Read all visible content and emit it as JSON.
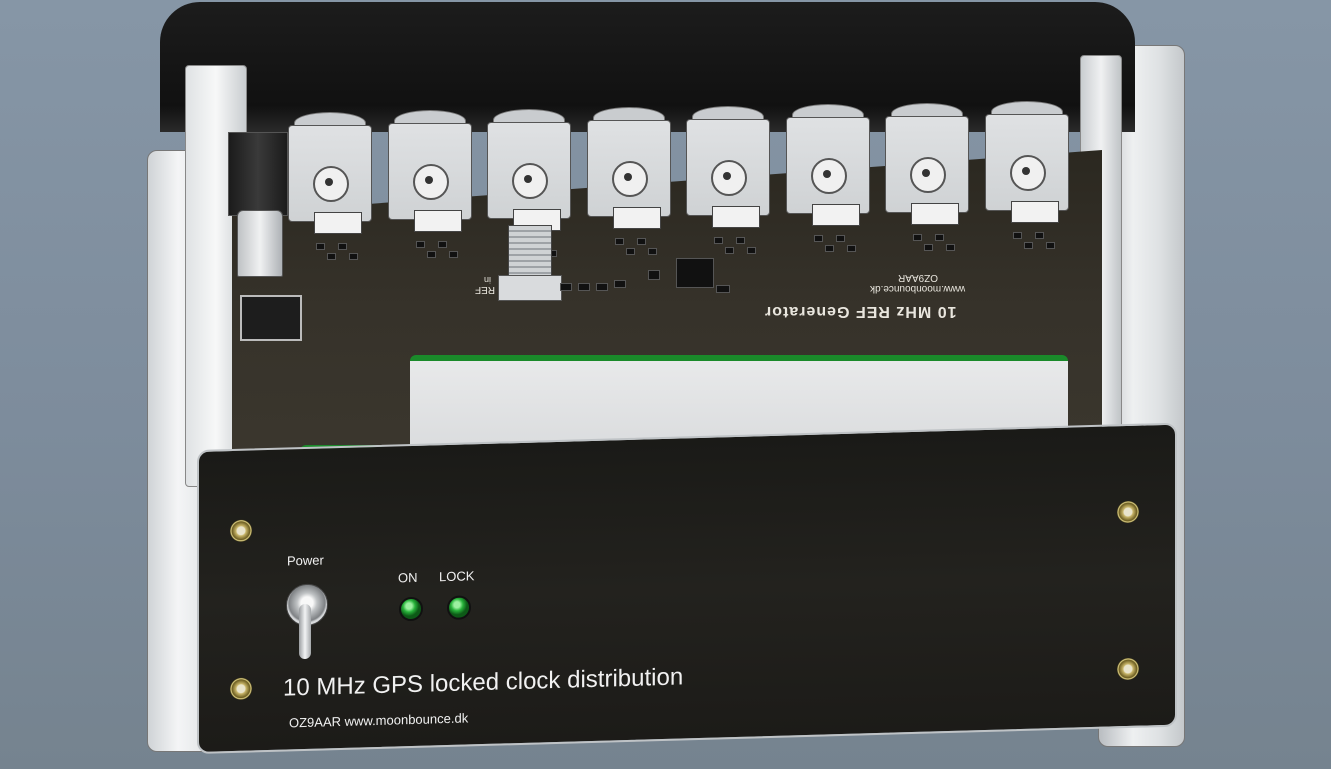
{
  "panel": {
    "power_label": "Power",
    "on_label": "ON",
    "lock_label": "LOCK",
    "title": "10 MHz GPS locked clock distribution",
    "credit": "OZ9AAR www.moonbounce.dk"
  },
  "pcb": {
    "title": "10 MHz REF Generator",
    "callsign": "OZ9AAR",
    "website": "www.moonbounce.dk",
    "ref_label": "REF",
    "ref_sub": "in"
  },
  "colors": {
    "led_on": "#27b23a",
    "pcb": "#36322a",
    "panel": "#1f1e1b",
    "gps_module_edge": "#1a8a2a"
  },
  "connectors": {
    "count": 8
  }
}
